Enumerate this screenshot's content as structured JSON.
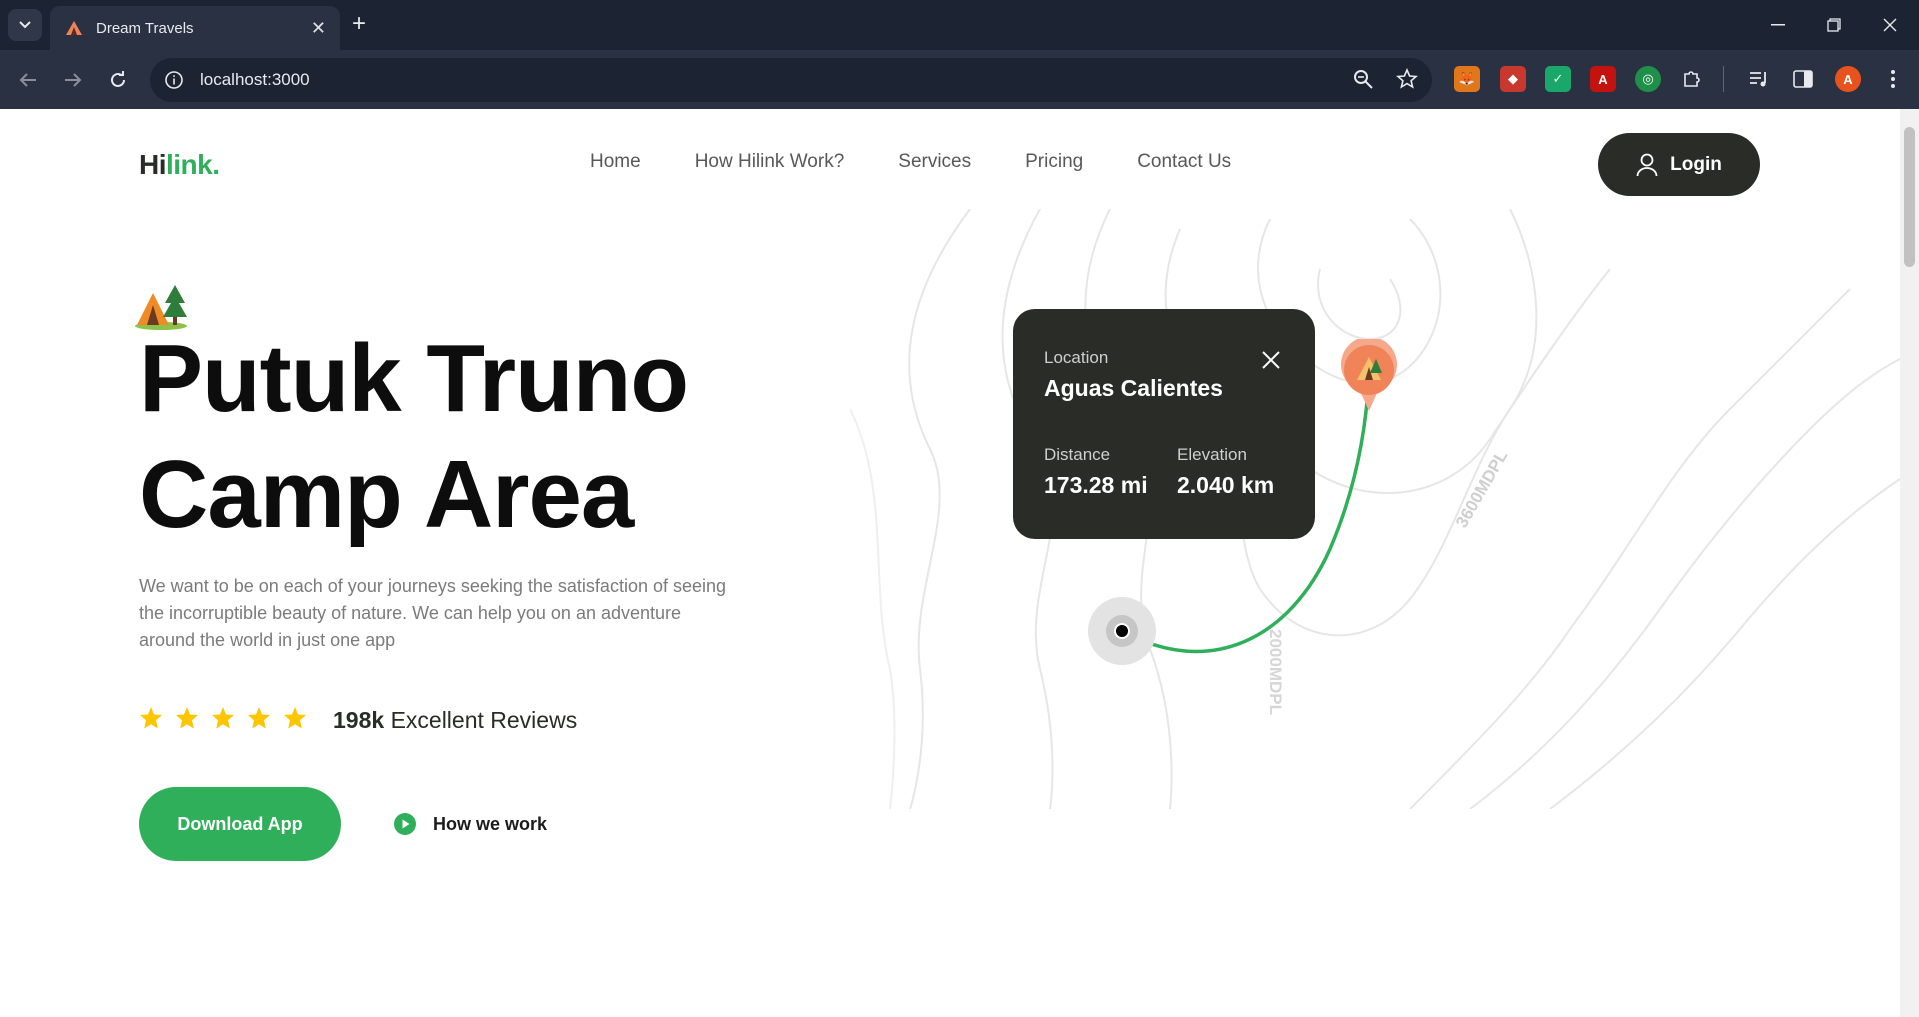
{
  "browser": {
    "tab_title": "Dream Travels",
    "url": "localhost:3000",
    "profile_initial": "A"
  },
  "site": {
    "logo_prefix": "Hi",
    "logo_suffix": "link.",
    "nav": [
      "Home",
      "How Hilink Work?",
      "Services",
      "Pricing",
      "Contact Us"
    ],
    "login_label": "Login"
  },
  "hero": {
    "title_line1": "Putuk Truno",
    "title_line2": "Camp Area",
    "description": "We want to be on each of your journeys seeking the satisfaction of seeing the incorruptible beauty of nature. We can help you on an adventure around the world in just one app",
    "rating_stars": 5,
    "review_count": "198k",
    "review_label": "Excellent Reviews",
    "download_label": "Download App",
    "how_label": "How we work"
  },
  "location_card": {
    "label": "Location",
    "name": "Aguas Calientes",
    "distance_label": "Distance",
    "distance_value": "173.28 mi",
    "elevation_label": "Elevation",
    "elevation_value": "2.040 km"
  },
  "map": {
    "contour_label_a": "3600MDPL",
    "contour_label_b": "2000MDPL"
  },
  "colors": {
    "brand_green": "#30af5b",
    "dark": "#292c27",
    "pin_orange": "#f08458",
    "star": "#fec601"
  }
}
